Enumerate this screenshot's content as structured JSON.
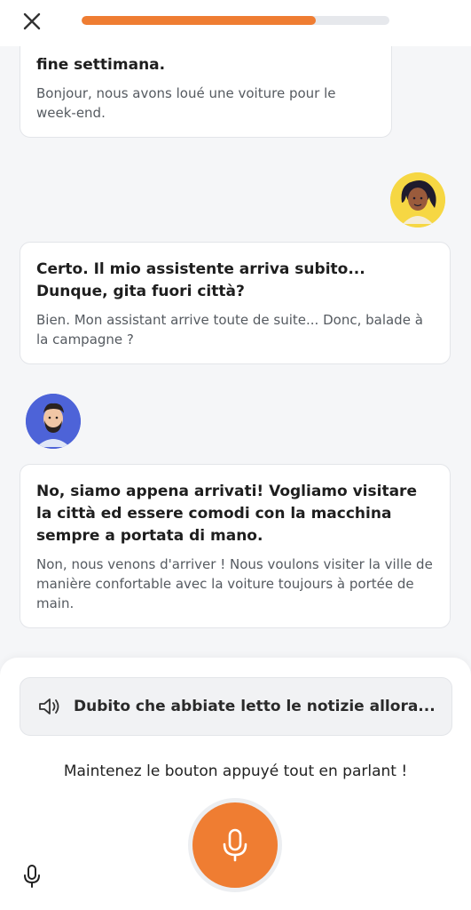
{
  "progress": {
    "value_percent": 76
  },
  "colors": {
    "accent": "#ef7d32",
    "progress_track": "#e6e8ec"
  },
  "messages": [
    {
      "italian": "fine settimana.",
      "french": "Bonjour, nous avons loué une voiture pour le week-end."
    },
    {
      "italian": "Certo. Il mio assistente arriva subito... Dunque, gita fuori città?",
      "french": "Bien. Mon assistant arrive toute de suite... Donc, balade à la campagne ?"
    },
    {
      "italian": "No, siamo appena arrivati! Vogliamo visitare la città ed essere comodi con la macchina sempre a portata di mano.",
      "french": "Non, nous venons d'arriver ! Nous voulons visiter la ville de manière confortable avec la voiture toujours à portée de main."
    }
  ],
  "icons": {
    "close": "close-icon",
    "speaker": "speaker-icon",
    "record": "microphone-icon",
    "mic_small": "microphone-icon"
  },
  "hint": {
    "text": "Dubito che abbiate letto le notizie allora..."
  },
  "instruction": "Maintenez le bouton appuyé tout en parlant !"
}
